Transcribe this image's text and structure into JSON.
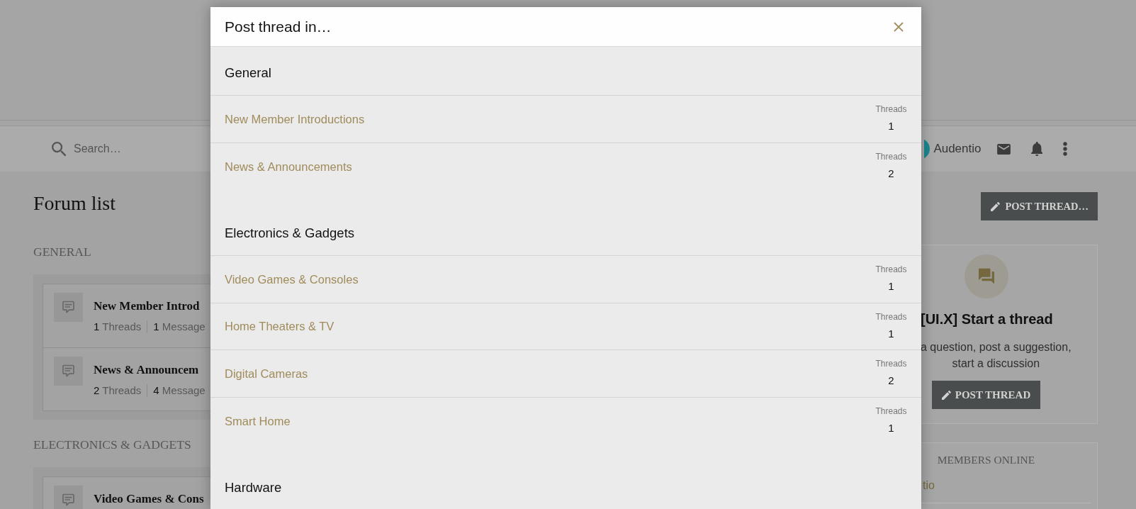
{
  "header": {
    "search": {
      "placeholder": "Search…"
    },
    "user": {
      "name": "Audentio"
    }
  },
  "page": {
    "title": "Forum list",
    "post_button": "POST THREAD…"
  },
  "categories": [
    {
      "title": "GENERAL",
      "forums": [
        {
          "name": "New Member Introd",
          "threads": "1",
          "threads_label": "Threads",
          "messages": "1",
          "messages_label": "Message"
        },
        {
          "name": "News & Announcem",
          "threads": "2",
          "threads_label": "Threads",
          "messages": "4",
          "messages_label": "Message"
        }
      ]
    },
    {
      "title": "ELECTRONICS & GADGETS",
      "forums": [
        {
          "name": "Video Games & Cons"
        }
      ]
    }
  ],
  "sidebar": {
    "start_thread": {
      "title": "[UI.X] Start a thread",
      "lines": [
        "a question, post a suggestion,",
        "start a discussion"
      ],
      "button": "POST THREAD"
    },
    "members_online": {
      "title": "MEMBERS ONLINE",
      "members": [
        "tio"
      ]
    }
  },
  "modal": {
    "title": "Post thread in…",
    "categories": [
      {
        "title": "General",
        "forums": [
          {
            "name": "New Member Introductions",
            "stat_label": "Threads",
            "threads": "1"
          },
          {
            "name": "News & Announcements",
            "stat_label": "Threads",
            "threads": "2"
          }
        ]
      },
      {
        "title": "Electronics & Gadgets",
        "forums": [
          {
            "name": "Video Games & Consoles",
            "stat_label": "Threads",
            "threads": "1"
          },
          {
            "name": "Home Theaters & TV",
            "stat_label": "Threads",
            "threads": "1"
          },
          {
            "name": "Digital Cameras",
            "stat_label": "Threads",
            "threads": "2"
          },
          {
            "name": "Smart Home",
            "stat_label": "Threads",
            "threads": "1"
          }
        ]
      },
      {
        "title": "Hardware"
      }
    ]
  }
}
